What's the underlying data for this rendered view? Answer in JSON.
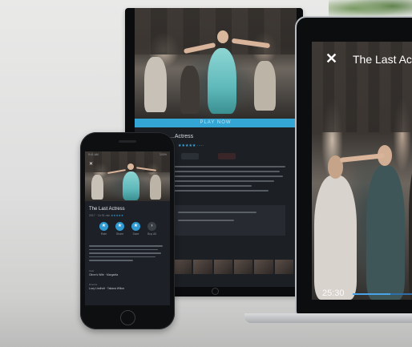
{
  "laptop": {
    "close_glyph": "✕",
    "title": "The Last Act",
    "time": "25:30",
    "progress": 0.52
  },
  "monitor": {
    "play_bar": "PLAY NOW",
    "title": "...Actress"
  },
  "phone": {
    "status_time": "9:41 AM",
    "status_battery": "100%",
    "close_glyph": "✕",
    "title": "The Last Actress",
    "meta": "2017 · 1h 51 min",
    "rating": "★★★★★",
    "actions": [
      {
        "label": "Rate",
        "icon": "★"
      },
      {
        "label": "Share",
        "icon": "★"
      },
      {
        "label": "Save",
        "icon": "★"
      },
      {
        "label": "Buy All",
        "icon": "›"
      }
    ],
    "fields": [
      {
        "label": "Cast",
        "value": "Oliver's Wife · Margarita"
      },
      {
        "label": "Director",
        "value": "Lucy Lindholt · Tatiana Wilton"
      }
    ]
  },
  "colors": {
    "accent": "#33a6d6",
    "background": "#dcdcdb",
    "screen_dark": "#1c1f24"
  }
}
